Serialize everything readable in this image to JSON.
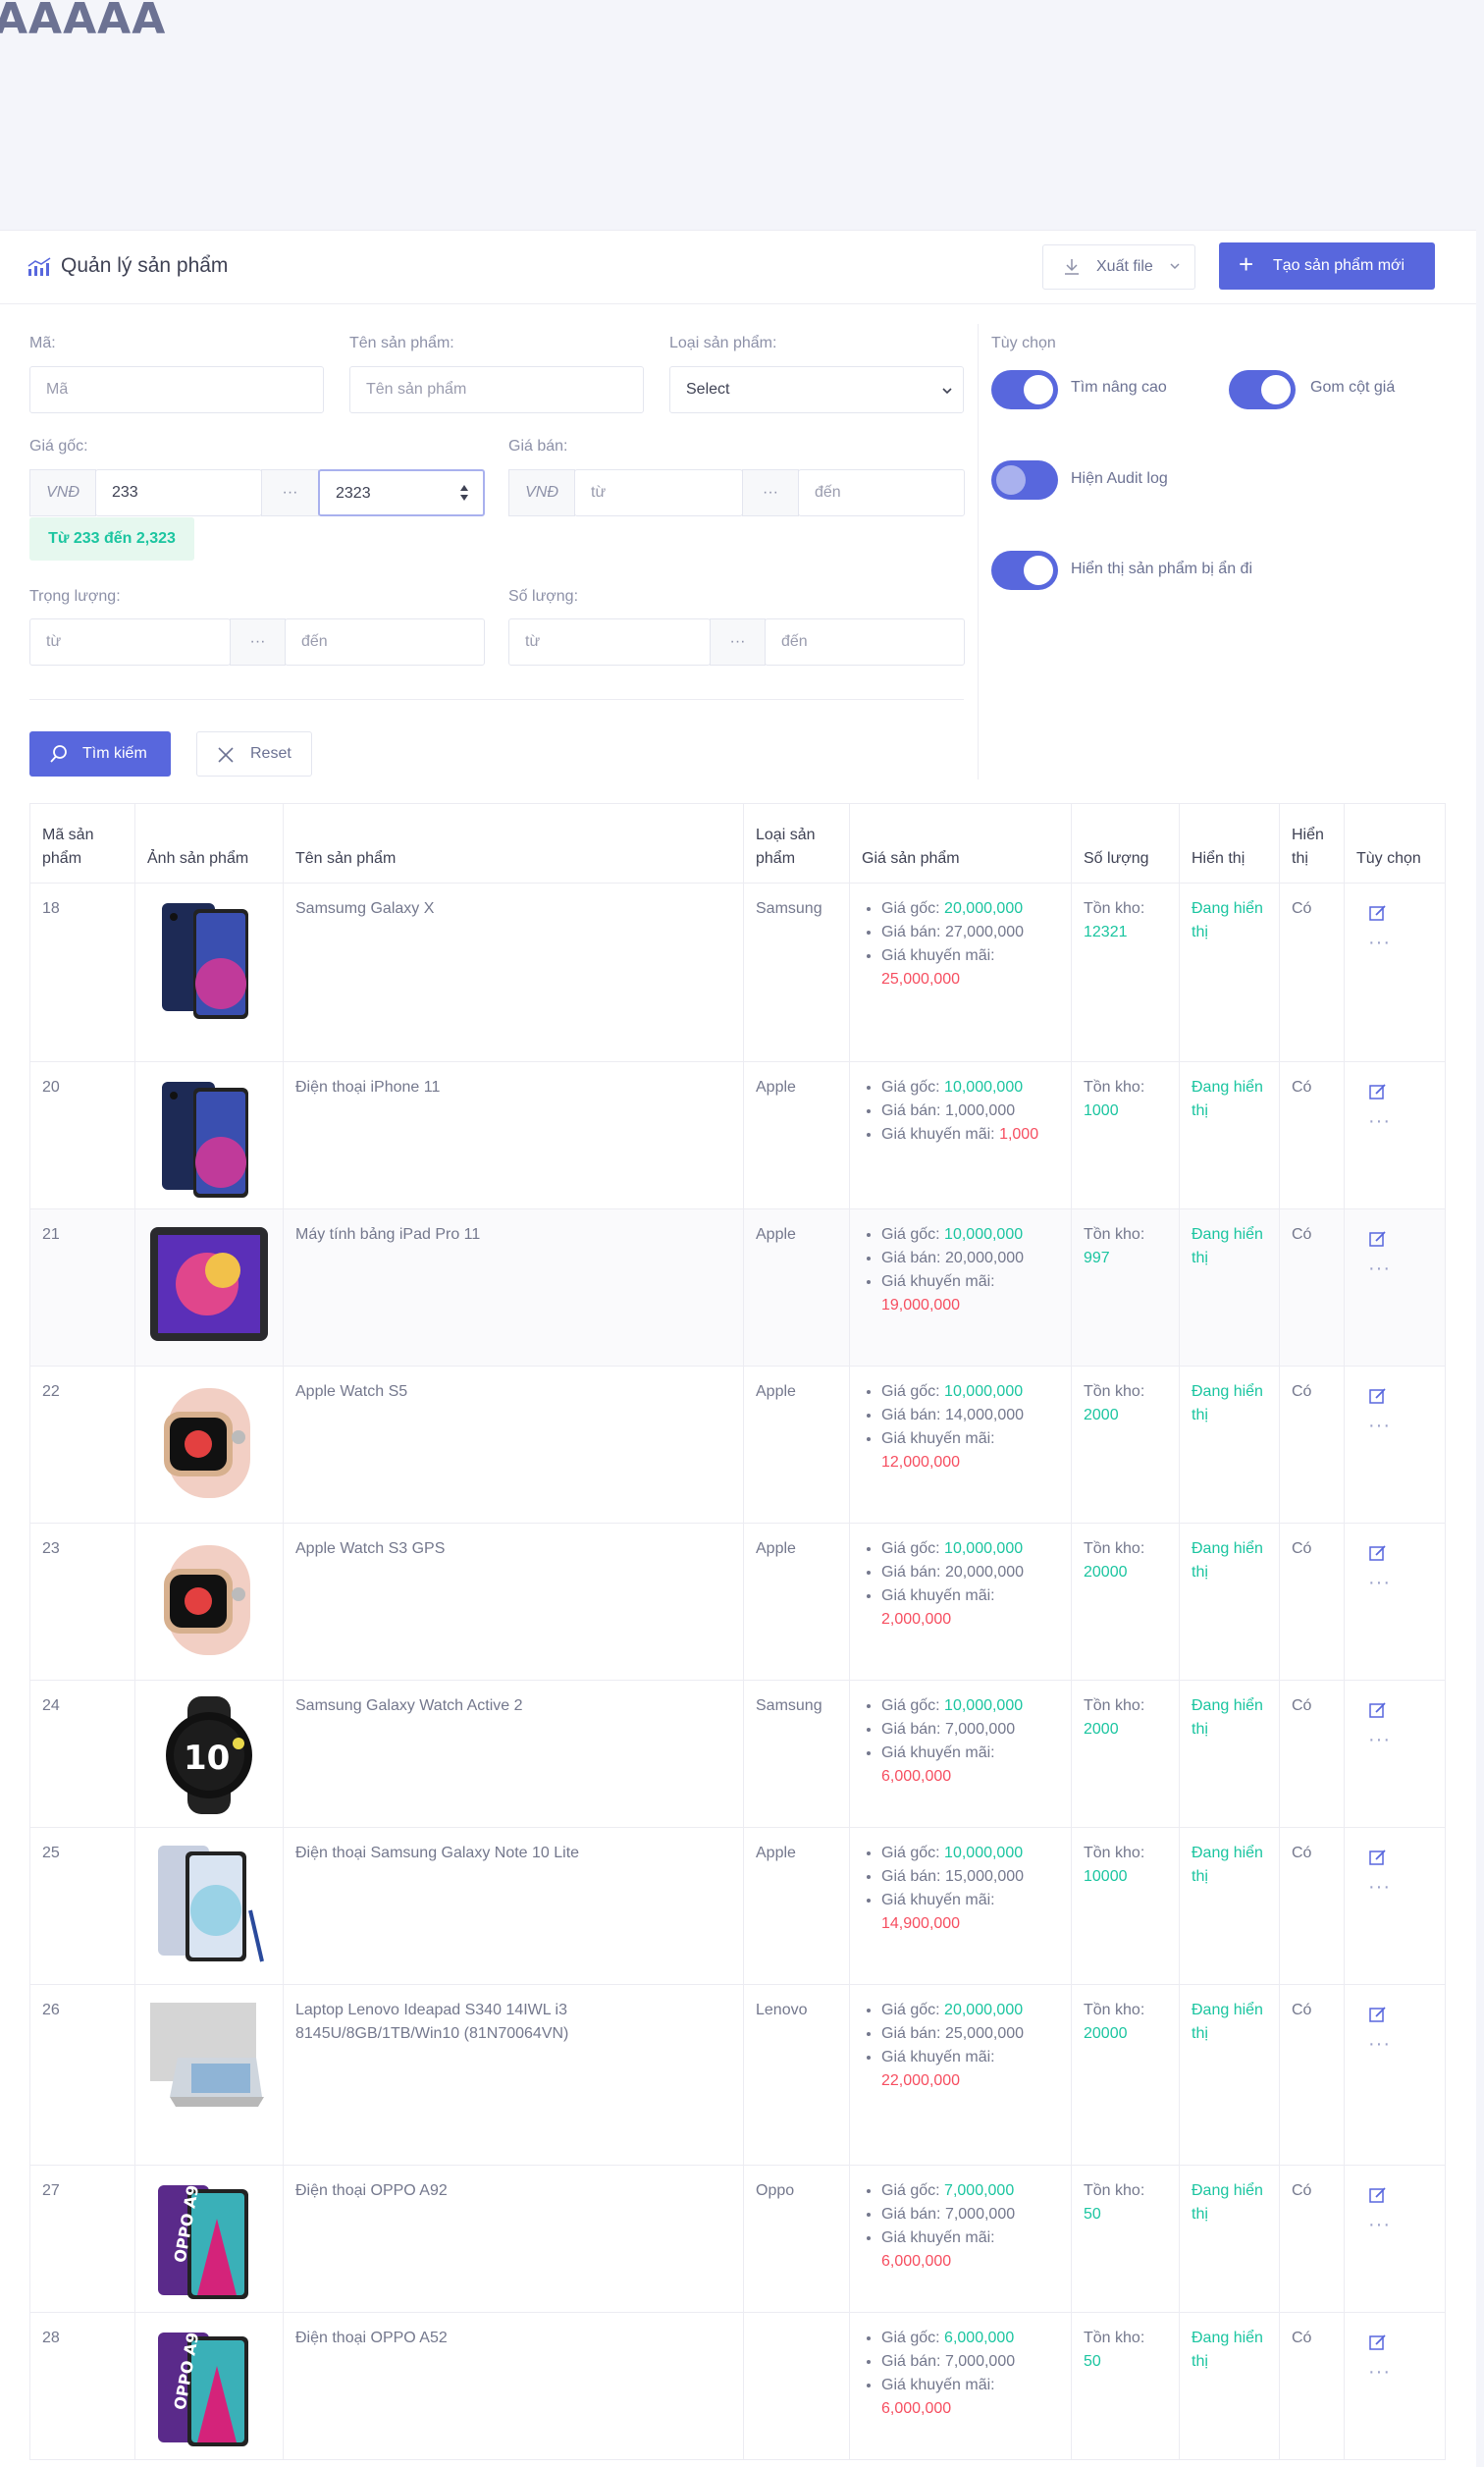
{
  "page_heading": "AAAAA",
  "header": {
    "title": "Quản lý sản phẩm",
    "export_label": "Xuất file",
    "create_label": "Tạo sản phẩm mới"
  },
  "filters": {
    "code_label": "Mã:",
    "code_placeholder": "Mã",
    "name_label": "Tên sản phẩm:",
    "name_placeholder": "Tên sản phẩm",
    "type_label": "Loại sản phẩm:",
    "type_value": "Select",
    "cost_label": "Giá gốc:",
    "currency": "VNĐ",
    "cost_from": "233",
    "cost_to": "2323",
    "range_text": "Từ 233 đến 2,323",
    "price_label": "Giá bán:",
    "price_from_placeholder": "từ",
    "price_to_placeholder": "đến",
    "weight_label": "Trọng lượng:",
    "weight_from_placeholder": "từ",
    "weight_to_placeholder": "đến",
    "qty_label": "Số lượng:",
    "qty_from_placeholder": "từ",
    "qty_to_placeholder": "đến",
    "ellipsis": "···",
    "search_label": "Tìm kiếm",
    "reset_label": "Reset"
  },
  "options": {
    "title": "Tùy chọn",
    "advanced_search": "Tìm nâng cao",
    "group_price": "Gom cột giá",
    "audit_log": "Hiện Audit log",
    "show_hidden": "Hiển thị sản phẩm bị ẩn đi"
  },
  "table": {
    "headers": [
      "Mã sản phẩm",
      "Ảnh sản phẩm",
      "Tên sản phẩm",
      "Loại sản phẩm",
      "Giá sản phẩm",
      "Số lượng",
      "Hiển thị",
      "Hiển thị",
      "Tùy chọn"
    ],
    "price_labels": {
      "cost": "Giá gốc:",
      "sell": "Giá bán:",
      "promo": "Giá khuyến mãi:"
    },
    "stock_label": "Tồn kho:",
    "status_text": "Đang hiển thị",
    "yes_text": "Có",
    "rows": [
      {
        "id": "18",
        "name": "Samsumg Galaxy X",
        "type": "Samsung",
        "cost": "20,000,000",
        "sell": "27,000,000",
        "promo": "25,000,000",
        "stock": "12321",
        "image": "samsung-phone"
      },
      {
        "id": "20",
        "name": "Điện thoại iPhone 11",
        "type": "Apple",
        "cost": "10,000,000",
        "sell": "1,000,000",
        "promo": "1,000",
        "stock": "1000",
        "image": "samsung-phone"
      },
      {
        "id": "21",
        "name": "Máy tính bảng iPad Pro 11",
        "type": "Apple",
        "cost": "10,000,000",
        "sell": "20,000,000",
        "promo": "19,000,000",
        "stock": "997",
        "image": "ipad"
      },
      {
        "id": "22",
        "name": "Apple Watch S5",
        "type": "Apple",
        "cost": "10,000,000",
        "sell": "14,000,000",
        "promo": "12,000,000",
        "stock": "2000",
        "image": "apple-watch"
      },
      {
        "id": "23",
        "name": "Apple Watch S3 GPS",
        "type": "Apple",
        "cost": "10,000,000",
        "sell": "20,000,000",
        "promo": "2,000,000",
        "stock": "20000",
        "image": "apple-watch"
      },
      {
        "id": "24",
        "name": "Samsung Galaxy Watch Active 2",
        "type": "Samsung",
        "cost": "10,000,000",
        "sell": "7,000,000",
        "promo": "6,000,000",
        "stock": "2000",
        "image": "galaxy-watch"
      },
      {
        "id": "25",
        "name": "Điện thoại Samsung Galaxy Note 10 Lite",
        "type": "Apple",
        "cost": "10,000,000",
        "sell": "15,000,000",
        "promo": "14,900,000",
        "stock": "10000",
        "image": "note-phone"
      },
      {
        "id": "26",
        "name": "Laptop Lenovo Ideapad S340 14IWL i3 8145U/8GB/1TB/Win10 (81N70064VN)",
        "type": "Lenovo",
        "cost": "20,000,000",
        "sell": "25,000,000",
        "promo": "22,000,000",
        "stock": "20000",
        "image": "laptop"
      },
      {
        "id": "27",
        "name": "Điện thoại OPPO A92",
        "type": "Oppo",
        "cost": "7,000,000",
        "sell": "7,000,000",
        "promo": "6,000,000",
        "stock": "50",
        "image": "oppo"
      },
      {
        "id": "28",
        "name": "Điện thoại OPPO A52",
        "type": "",
        "cost": "6,000,000",
        "sell": "7,000,000",
        "promo": "6,000,000",
        "stock": "50",
        "image": "oppo"
      }
    ]
  },
  "colors": {
    "primary": "#5867dd",
    "success": "#1bc5a0",
    "danger": "#f64e60"
  }
}
